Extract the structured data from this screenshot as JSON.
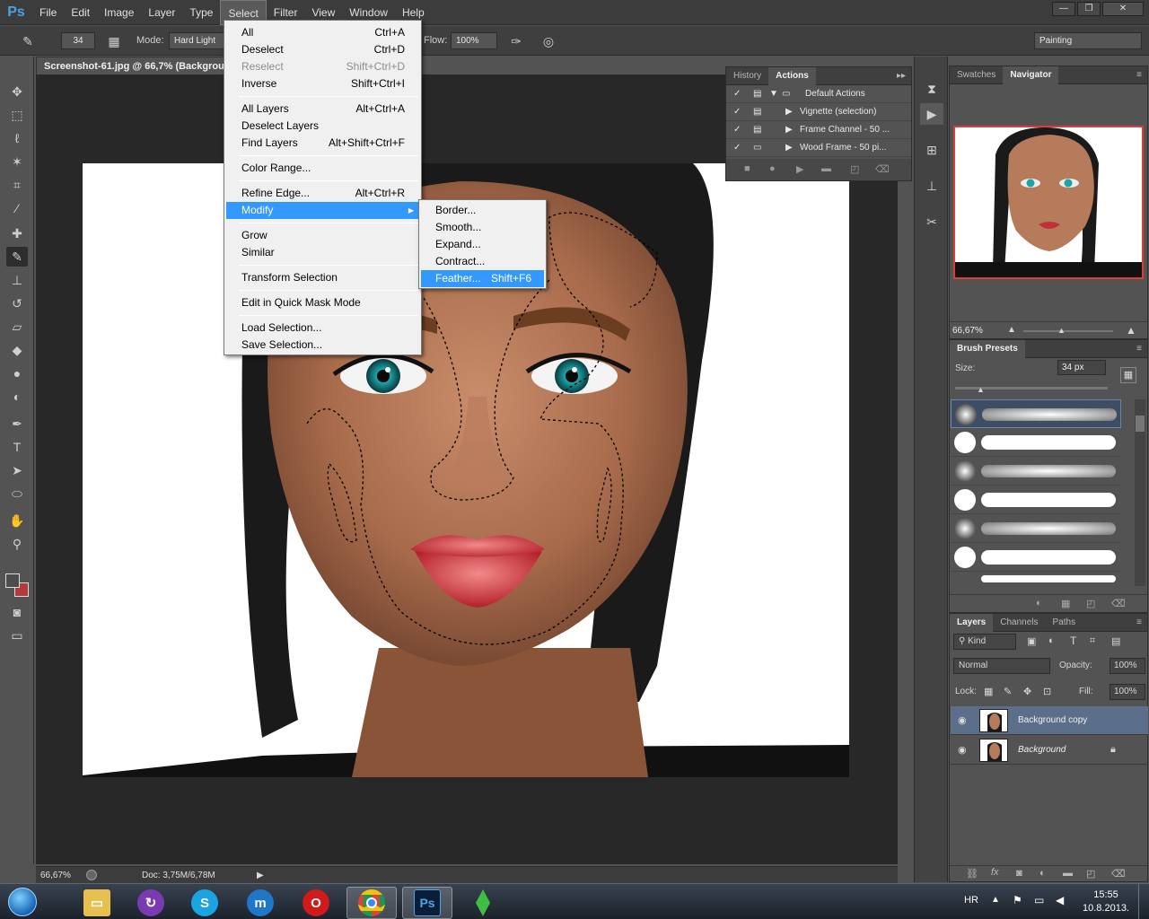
{
  "app": {
    "logo": "Ps"
  },
  "menubar": {
    "items": [
      "File",
      "Edit",
      "Image",
      "Layer",
      "Type",
      "Select",
      "Filter",
      "View",
      "Window",
      "Help"
    ],
    "active": "Select"
  },
  "window_controls": {
    "minimize": "—",
    "restore": "❐",
    "close": "✕"
  },
  "options": {
    "brush_size": "34",
    "mode_label": "Mode:",
    "mode_value": "Hard Light",
    "flow_label": "Flow:",
    "flow_value": "100%",
    "workspace": "Painting"
  },
  "document": {
    "tab_title": "Screenshot-61.jpg @ 66,7% (Background"
  },
  "status": {
    "zoom": "66,67%",
    "doc": "Doc: 3,75M/6,78M"
  },
  "select_menu": {
    "items": [
      {
        "label": "All",
        "shortcut": "Ctrl+A"
      },
      {
        "label": "Deselect",
        "shortcut": "Ctrl+D"
      },
      {
        "label": "Reselect",
        "shortcut": "Shift+Ctrl+D"
      },
      {
        "label": "Inverse",
        "shortcut": "Shift+Ctrl+I"
      },
      {
        "label": "All Layers",
        "shortcut": "Alt+Ctrl+A"
      },
      {
        "label": "Deselect Layers",
        "shortcut": ""
      },
      {
        "label": "Find Layers",
        "shortcut": "Alt+Shift+Ctrl+F"
      },
      {
        "label": "Color Range...",
        "shortcut": ""
      },
      {
        "label": "Refine Edge...",
        "shortcut": "Alt+Ctrl+R"
      },
      {
        "label": "Modify",
        "shortcut": ""
      },
      {
        "label": "Grow",
        "shortcut": ""
      },
      {
        "label": "Similar",
        "shortcut": ""
      },
      {
        "label": "Transform Selection",
        "shortcut": ""
      },
      {
        "label": "Edit in Quick Mask Mode",
        "shortcut": ""
      },
      {
        "label": "Load Selection...",
        "shortcut": ""
      },
      {
        "label": "Save Selection...",
        "shortcut": ""
      }
    ],
    "submenu_arrow": "▶"
  },
  "modify_submenu": {
    "items": [
      {
        "label": "Border...",
        "shortcut": ""
      },
      {
        "label": "Smooth...",
        "shortcut": ""
      },
      {
        "label": "Expand...",
        "shortcut": ""
      },
      {
        "label": "Contract...",
        "shortcut": ""
      },
      {
        "label": "Feather...",
        "shortcut": "Shift+F6"
      }
    ]
  },
  "actions_panel": {
    "tabs": [
      "History",
      "Actions"
    ],
    "active_tab": "Actions",
    "menu_glyph": "▸▸",
    "rows": [
      "Default Actions",
      "Vignette (selection)",
      "Frame Channel - 50 ...",
      "Wood Frame - 50 pi..."
    ]
  },
  "navigator_panel": {
    "tabs": [
      "Swatches",
      "Navigator"
    ],
    "active_tab": "Navigator",
    "zoom": "66,67%"
  },
  "brush_presets": {
    "title": "Brush Presets",
    "size_label": "Size:",
    "size_value": "34 px"
  },
  "layers_panel": {
    "tabs": [
      "Layers",
      "Channels",
      "Paths"
    ],
    "active_tab": "Layers",
    "filter_kind": "Kind",
    "blend_mode": "Normal",
    "opacity_label": "Opacity:",
    "opacity_value": "100%",
    "lock_label": "Lock:",
    "fill_label": "Fill:",
    "fill_value": "100%",
    "layers": [
      "Background copy",
      "Background"
    ]
  },
  "taskbar": {
    "language": "HR",
    "time": "15:55",
    "date": "10.8.2013."
  },
  "colors": {
    "ui_bg": "#535353",
    "menu_highlight": "#3399ff",
    "ps_blue": "#4ba3e3",
    "layer_selected": "#5c6f8a"
  }
}
